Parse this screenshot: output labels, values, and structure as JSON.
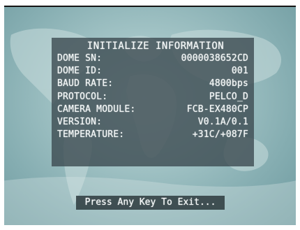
{
  "osd": {
    "title": "INITIALIZE INFORMATION",
    "rows": [
      {
        "label": "DOME SN:",
        "value": "0000038652CD"
      },
      {
        "label": "DOME ID:",
        "value": "001"
      },
      {
        "label": "BAUD RATE:",
        "value": "4800bps"
      },
      {
        "label": "PROTOCOL:",
        "value": "PELCO_D"
      },
      {
        "label": "CAMERA MODULE:",
        "value": "FCB-EX480CP"
      },
      {
        "label": "VERSION:",
        "value": "V0.1A/0.1"
      },
      {
        "label": "TEMPERATURE:",
        "value": "+31C/+087F"
      }
    ]
  },
  "prompt": {
    "text": "Press Any Key To Exit..."
  },
  "colors": {
    "background": "#a3c4c6",
    "panel": "#3a484e",
    "text": "#f2f6f6"
  }
}
